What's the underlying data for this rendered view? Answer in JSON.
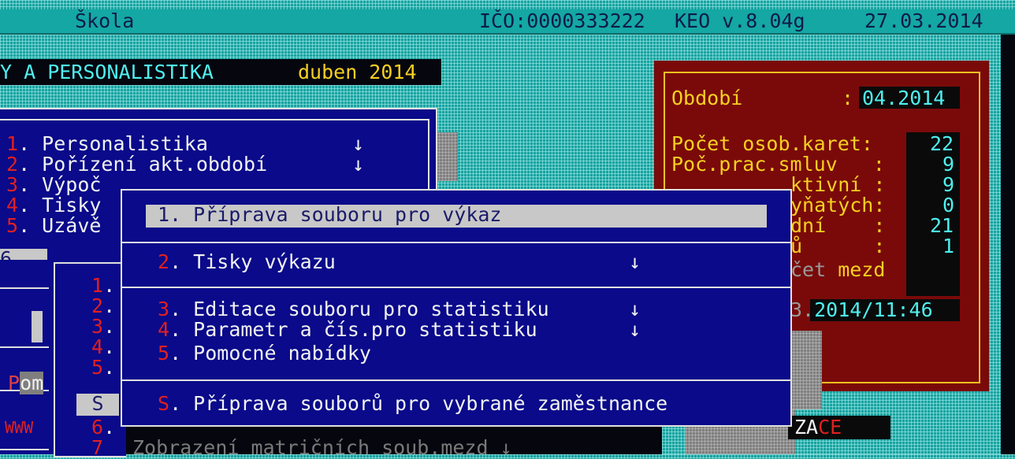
{
  "header": {
    "school": "Škola",
    "ico": "IČO:0000333222",
    "version": "KEO v.8.04g",
    "date": "27.03.2014"
  },
  "band": {
    "module": "Y A PERSONALISTIKA",
    "period": "duben 2014"
  },
  "main_menu": {
    "items": [
      {
        "key": "1",
        "label": ". Personalistika",
        "arrow": "↓"
      },
      {
        "key": "2",
        "label": ". Pořízení akt.období",
        "arrow": "↓"
      },
      {
        "key": "3",
        "label": ". Výpoč"
      },
      {
        "key": "4",
        "label": ". Tisky"
      },
      {
        "key": "5",
        "label": ". Uzávě"
      }
    ],
    "item6": "6.",
    "pom": "Pom",
    "www": "WWW"
  },
  "sub_menu": {
    "items": [
      {
        "key": "1",
        "label": "."
      },
      {
        "key": "2",
        "label": "."
      },
      {
        "key": "3",
        "label": "."
      },
      {
        "key": "4",
        "label": "."
      },
      {
        "key": "5",
        "label": "."
      },
      {
        "key": "6",
        "label": "."
      },
      {
        "key": "7",
        "label": ""
      }
    ],
    "s_key": "S"
  },
  "popup": {
    "item1": "1. Příprava souboru pro výkaz",
    "item2_key": "2",
    "item2": ". Tisky výkazu",
    "item2_arrow": "↓",
    "item3_key": "3",
    "item3": ". Editace souboru pro statistiku",
    "item3_arrow": "↓",
    "item4_key": "4",
    "item4": ". Parametr a čís.pro statistiku",
    "item4_arrow": "↓",
    "item5_key": "5",
    "item5": ". Pomocné nabídky",
    "itemS_key": "S",
    "itemS": ". Příprava souborů pro vybrané zaměstnance"
  },
  "info": {
    "obdobi_label": "Období",
    "obdobi_sep": ":",
    "obdobi_value": "04.2014",
    "rows": [
      {
        "label": "Počet osob.karet:",
        "value": "22"
      },
      {
        "label": "Poč.prac.smluv   :",
        "value": "9"
      },
      {
        "label": "ktivní :",
        "value": "9"
      },
      {
        "label": "yňatých:",
        "value": "0"
      },
      {
        "label": "dní    :",
        "value": "21"
      },
      {
        "label": "ů      :",
        "value": "1"
      }
    ],
    "vypocet_prefix": "čet",
    "vypocet_suffix": " mezd",
    "timestamp_prefix": "3.",
    "timestamp": "2014/11:46"
  },
  "bottom": {
    "line": "Zobrazení matričních soub.mezd ↓",
    "zace_a": "ZA",
    "zace_b": "CE"
  }
}
